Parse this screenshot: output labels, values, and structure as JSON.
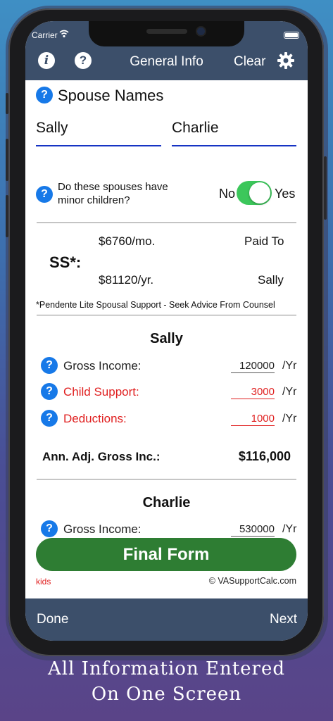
{
  "status": {
    "carrier": "Carrier"
  },
  "nav": {
    "info_icon": "i",
    "help_icon": "?",
    "title": "General Info",
    "clear": "Clear",
    "settings_icon": "gear-icon"
  },
  "spouse": {
    "heading": "Spouse Names",
    "name1": "Sally",
    "name2": "Charlie",
    "minor_question": "Do these spouses have minor children?",
    "toggle_no": "No",
    "toggle_yes": "Yes",
    "toggle_on": true
  },
  "support": {
    "label": "SS*:",
    "monthly": "$6760/mo.",
    "yearly": "$81120/yr.",
    "paid_to_label": "Paid To",
    "paid_to": "Sally",
    "footnote": "*Pendente Lite Spousal Support - Seek Advice From Counsel"
  },
  "sally": {
    "name": "Sally",
    "gross_label": "Gross Income:",
    "gross_value": "120000",
    "child_label": "Child Support:",
    "child_value": "3000",
    "deduct_label": "Deductions:",
    "deduct_value": "1000",
    "unit": "/Yr",
    "adj_label": "Ann. Adj. Gross Inc.:",
    "adj_value": "$116,000"
  },
  "charlie": {
    "name": "Charlie",
    "gross_label": "Gross Income:",
    "gross_value": "530000",
    "unit": "/Yr"
  },
  "footer": {
    "final_button": "Final Form",
    "kids": "kids",
    "copyright": "© VASupportCalc.com"
  },
  "bottombar": {
    "done": "Done",
    "next": "Next"
  },
  "caption": {
    "line1": "All Information Entered",
    "line2": "On One Screen"
  },
  "colors": {
    "accent": "#1779e8",
    "red": "#e02020",
    "green": "#2e7d33",
    "nav": "#3c4f6a"
  }
}
